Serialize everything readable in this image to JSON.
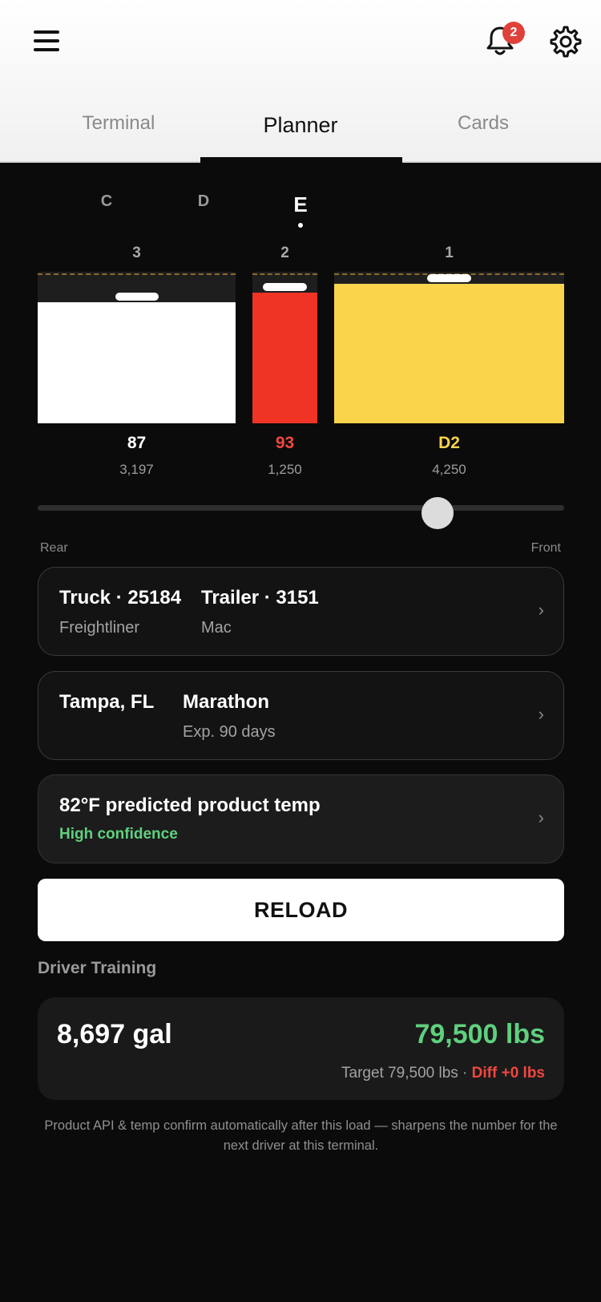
{
  "header": {
    "notification_count": "2",
    "tabs": [
      {
        "label": "Terminal",
        "active": false
      },
      {
        "label": "Planner",
        "active": true
      },
      {
        "label": "Cards",
        "active": false
      }
    ]
  },
  "compartment_tabs": [
    {
      "label": "C",
      "active": false
    },
    {
      "label": "D",
      "active": false
    },
    {
      "label": "E",
      "active": true
    }
  ],
  "tanks": [
    {
      "number": "3",
      "grade": "87",
      "gallons": "3,197",
      "fill_fraction": 0.8,
      "color": "#ffffff",
      "grade_color": "#ffffff"
    },
    {
      "number": "2",
      "grade": "93",
      "gallons": "1,250",
      "fill_fraction": 0.86,
      "color": "#ef3426",
      "grade_color": "#f0473f"
    },
    {
      "number": "1",
      "grade": "D2",
      "gallons": "4,250",
      "fill_fraction": 0.92,
      "color": "#fad44b",
      "grade_color": "#fad44b"
    }
  ],
  "balance_slider": {
    "rear_label": "Rear",
    "front_label": "Front",
    "value_fraction": 0.76
  },
  "equipment": {
    "truck_title": "Truck · 25184",
    "truck_sub": "Freightliner",
    "trailer_title": "Trailer · 3151",
    "trailer_sub": "Mac",
    "chevron": "›"
  },
  "terminal": {
    "city": "Tampa, FL",
    "supplier": "Marathon",
    "expiry": "Exp. 90 days",
    "chevron": "›"
  },
  "temperature": {
    "title": "82°F predicted product temp",
    "confidence": "High confidence",
    "chevron": "›"
  },
  "reload_label": "RELOAD",
  "training": {
    "section_title": "Driver Training",
    "total_gallons": "8,697 gal",
    "total_weight": "79,500 lbs",
    "target": "Target 79,500 lbs · ",
    "diff": "Diff +0 lbs"
  },
  "footnote": "Product API & temp confirm automatically after this load — sharpens the number for the next driver at this terminal.",
  "colors": {
    "accent_green": "#5fd07e",
    "alert_red": "#f0473f",
    "diesel_yellow": "#fad44b"
  }
}
